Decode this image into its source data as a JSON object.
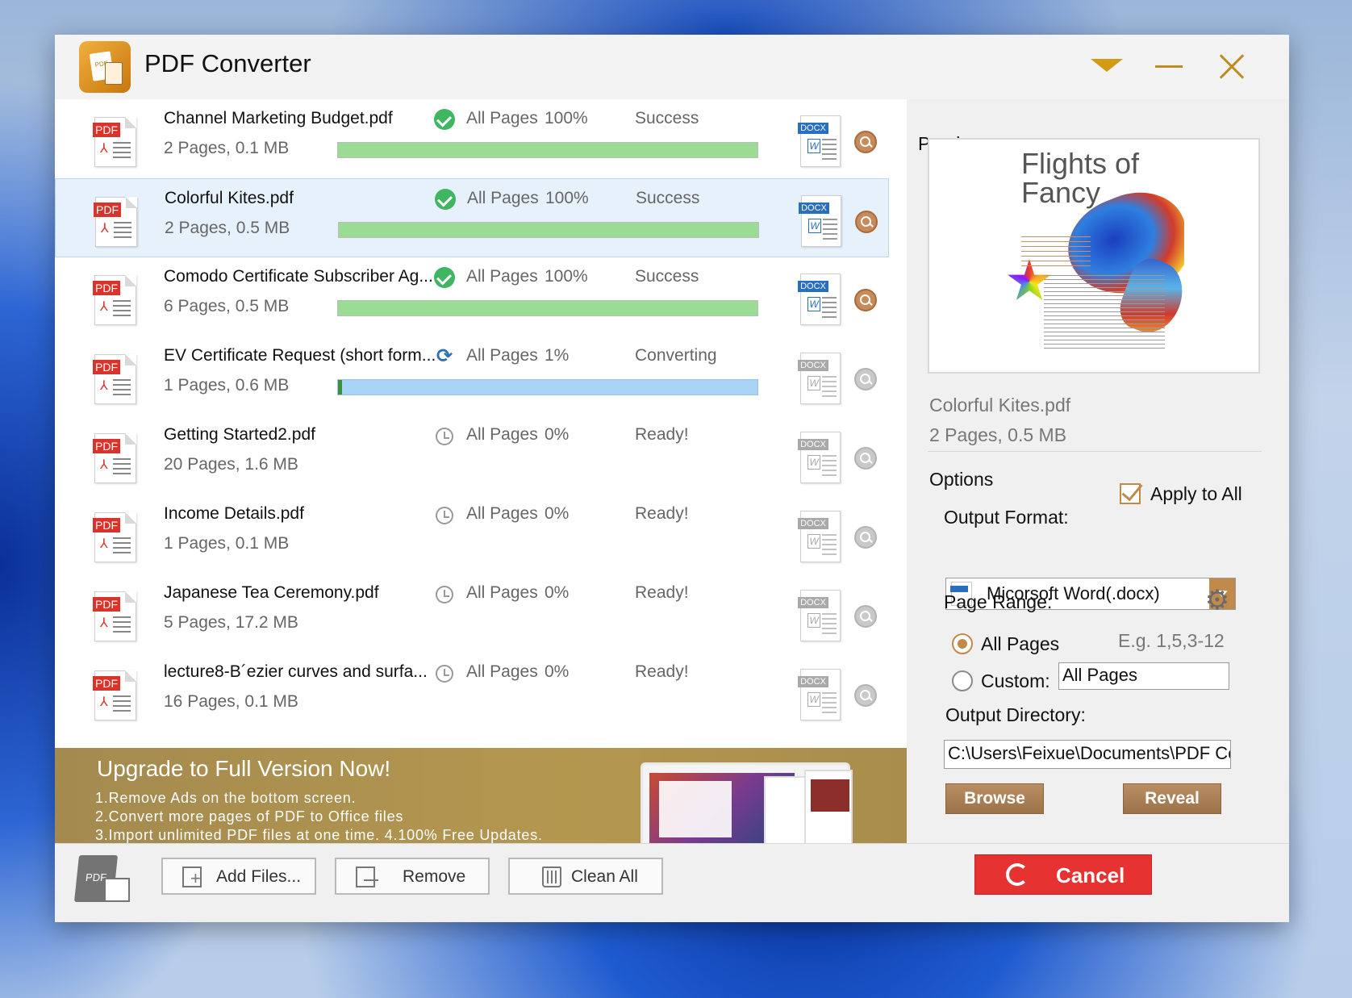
{
  "app": {
    "title": "PDF Converter"
  },
  "files": [
    {
      "name": "Channel Marketing Budget.pdf",
      "meta": "2 Pages, 0.1 MB",
      "pages": "All Pages",
      "percent": "100%",
      "progress": 1.0,
      "status": "Success",
      "state": "success"
    },
    {
      "name": "Colorful Kites.pdf",
      "meta": "2 Pages, 0.5 MB",
      "pages": "All Pages",
      "percent": "100%",
      "progress": 1.0,
      "status": "Success",
      "state": "success"
    },
    {
      "name": "Comodo Certificate Subscriber Ag...",
      "meta": "6 Pages, 0.5 MB",
      "pages": "All Pages",
      "percent": "100%",
      "progress": 1.0,
      "status": "Success",
      "state": "success"
    },
    {
      "name": "EV Certificate Request (short form...",
      "meta": "1 Pages, 0.6 MB",
      "pages": "All Pages",
      "percent": "1%",
      "progress": 0.01,
      "status": "Converting",
      "state": "converting"
    },
    {
      "name": "Getting Started2.pdf",
      "meta": "20 Pages, 1.6 MB",
      "pages": "All Pages",
      "percent": "0%",
      "progress": 0,
      "status": "Ready!",
      "state": "ready"
    },
    {
      "name": "Income Details.pdf",
      "meta": "1 Pages, 0.1 MB",
      "pages": "All Pages",
      "percent": "0%",
      "progress": 0,
      "status": "Ready!",
      "state": "ready"
    },
    {
      "name": "Japanese Tea Ceremony.pdf",
      "meta": "5 Pages, 17.2 MB",
      "pages": "All Pages",
      "percent": "0%",
      "progress": 0,
      "status": "Ready!",
      "state": "ready"
    },
    {
      "name": "lecture8-B´ezier curves and surfa...",
      "meta": "16 Pages, 0.1 MB",
      "pages": "All Pages",
      "percent": "0%",
      "progress": 0,
      "status": "Ready!",
      "state": "ready"
    }
  ],
  "selected_index": 1,
  "icons": {
    "pdf_tag": "PDF",
    "docx_tag": "DOCX",
    "docx_letter": "W"
  },
  "banner": {
    "title": "Upgrade to Full Version Now!",
    "lines": [
      "1.Remove Ads on the bottom screen.",
      "2.Convert more pages of PDF to Office files",
      "3.Import unlimited PDF files at one time. 4.100% Free Updates."
    ]
  },
  "preview": {
    "heading": "Preview",
    "doc_title_line1": "Flights of",
    "doc_title_line2": "Fancy",
    "file_name": "Colorful Kites.pdf",
    "file_meta": "2 Pages, 0.5 MB"
  },
  "options": {
    "heading": "Options",
    "apply_to_all": "Apply to All",
    "apply_to_all_checked": true,
    "output_format_label": "Output Format:",
    "output_format_value": "Micorsoft Word(.docx)",
    "page_range_label": "Page Range:",
    "all_pages_label": "All Pages",
    "example": "E.g. 1,5,3-12",
    "custom_label": "Custom:",
    "custom_value": "All Pages",
    "output_dir_label": "Output Directory:",
    "output_dir_value": "C:\\Users\\Feixue\\Documents\\PDF Co",
    "browse": "Browse",
    "reveal": "Reveal"
  },
  "toolbar": {
    "add_files": "Add Files...",
    "remove": "Remove",
    "clean_all": "Clean All",
    "cancel": "Cancel"
  },
  "colors": {
    "accent": "#c28a4a",
    "success_bar": "#9bdc94",
    "converting_bar": "#a8d4f5",
    "cancel": "#e73232",
    "banner": "#b4974f"
  }
}
